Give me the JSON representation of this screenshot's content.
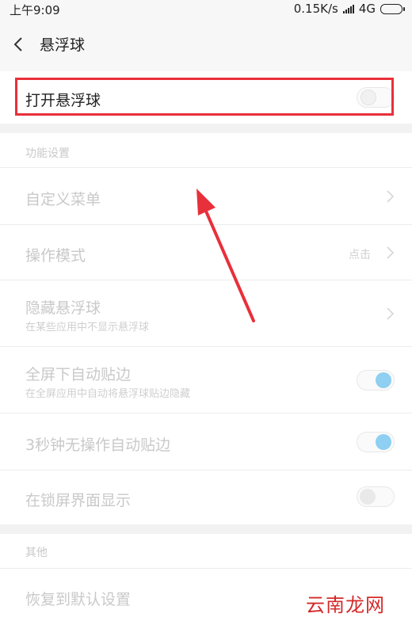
{
  "status_bar": {
    "time": "上午9:09",
    "network_speed": "0.15K/s",
    "network_type": "4G",
    "icons": [
      "signal-icon",
      "battery-icon"
    ]
  },
  "header": {
    "title": "悬浮球",
    "back_icon": "chevron-left-icon"
  },
  "main_toggle": {
    "label": "打开悬浮球",
    "enabled": false
  },
  "section_function": {
    "header": "功能设置",
    "items": [
      {
        "label": "自定义菜单",
        "sub": "",
        "value": ""
      },
      {
        "label": "操作模式",
        "sub": "",
        "value": "点击"
      },
      {
        "label": "隐藏悬浮球",
        "sub": "在某些应用中不显示悬浮球",
        "value": ""
      },
      {
        "label": "全屏下自动贴边",
        "sub": "在全屏应用中自动将悬浮球贴边隐藏",
        "toggle": true
      },
      {
        "label": "3秒钟无操作自动贴边",
        "sub": "",
        "toggle": true
      },
      {
        "label": "在锁屏界面显示",
        "sub": "",
        "toggle": false
      }
    ]
  },
  "section_other": {
    "header": "其他",
    "items": [
      {
        "label": "恢复到默认设置"
      }
    ]
  },
  "annotation": {
    "highlight_color": "#e8303a",
    "arrow_color": "#e8303a"
  },
  "watermark": "云南龙网"
}
